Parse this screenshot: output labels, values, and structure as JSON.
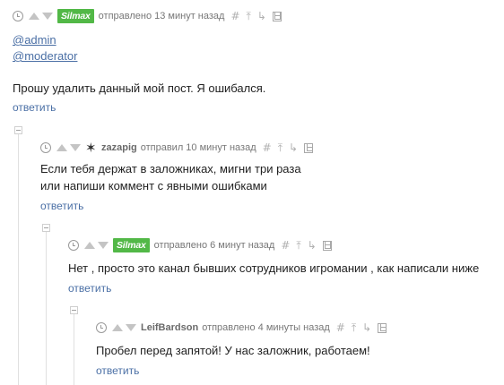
{
  "comments": [
    {
      "author": "Silmax",
      "posted": "отправлено 13 минут назад",
      "mentions": [
        "@admin",
        "@moderator"
      ],
      "lines": [
        "Прошу удалить данный мой пост. Я ошибался."
      ],
      "reply": "ответить"
    },
    {
      "author": "zazapig",
      "posted": "отправил 10 минут назад",
      "lines": [
        "Если тебя держат в заложниках, мигни три раза",
        "или напиши коммент с явными ошибками"
      ],
      "reply": "ответить"
    },
    {
      "author": "Silmax",
      "posted": "отправлено 6 минут назад",
      "lines": [
        "Нет , просто это канал бывших сотрудников игромании , как написали ниже"
      ],
      "reply": "ответить"
    },
    {
      "author": "LeifBardson",
      "posted": "отправлено 4 минуты назад",
      "lines": [
        "Пробел перед запятой! У нас заложник, работаем!"
      ],
      "reply": "ответить"
    }
  ],
  "meta_icons": {
    "hash": "#",
    "parent": "⤒",
    "thread": "↳"
  },
  "colors": {
    "badge": "#52b847",
    "link": "#4a6fa5",
    "meta": "#777777"
  }
}
